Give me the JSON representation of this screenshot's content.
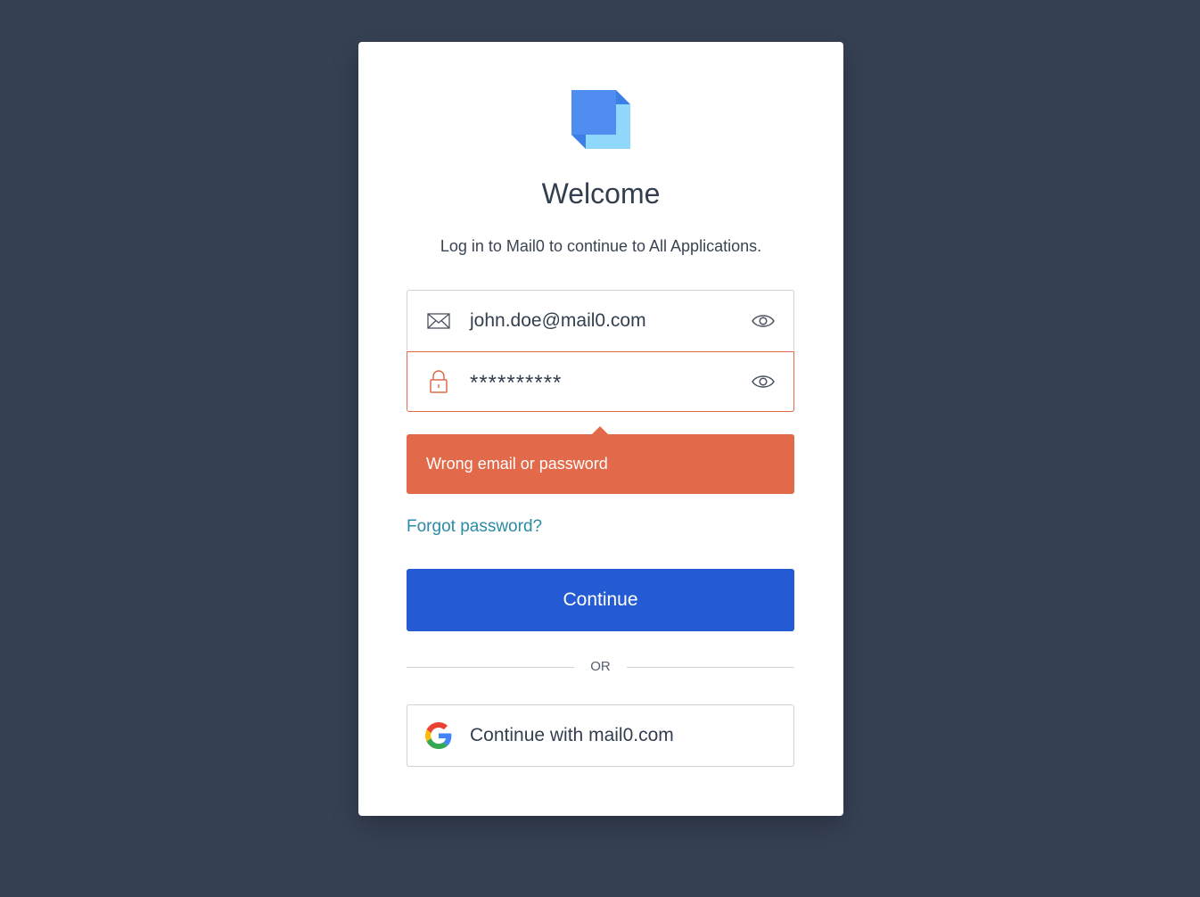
{
  "brand": {
    "logo_icon": "stacked-square-logo",
    "accent_color": "#245bd4",
    "background_color": "#364154"
  },
  "header": {
    "title": "Welcome",
    "subtitle": "Log in to Mail0 to continue to All Applications."
  },
  "form": {
    "email": {
      "icon": "envelope-icon",
      "value": "john.doe@mail0.com",
      "toggle_icon": "eye-icon"
    },
    "password": {
      "icon": "lock-icon",
      "value": "**********",
      "toggle_icon": "eye-icon",
      "state": "error"
    },
    "error_message": "Wrong email or password",
    "error_color": "#e2694a",
    "forgot_link": "Forgot password?",
    "submit_label": "Continue"
  },
  "divider": {
    "label": "OR"
  },
  "social": {
    "icon": "google-icon",
    "label": "Continue with mail0.com"
  }
}
